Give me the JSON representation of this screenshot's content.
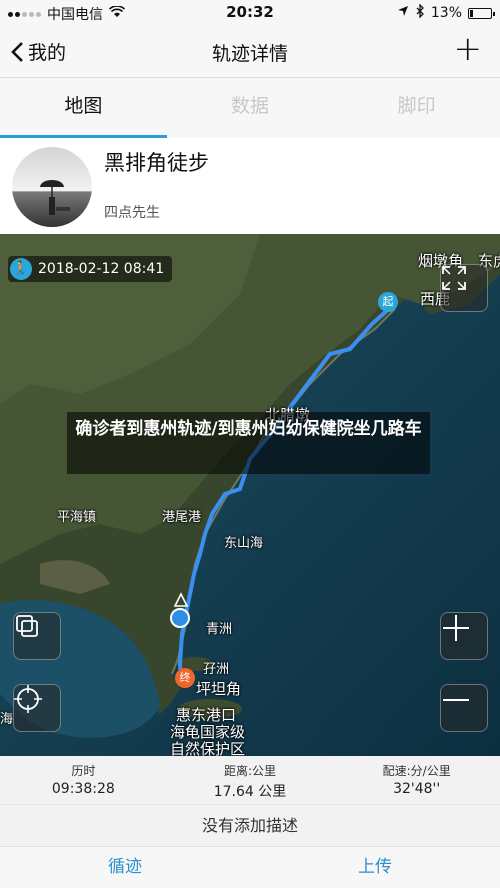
{
  "status_bar": {
    "carrier": "中国电信",
    "time": "20:32",
    "battery": "13%",
    "battery_level": 0.13
  },
  "nav": {
    "back_label": "我的",
    "title": "轨迹详情",
    "add_label": "+"
  },
  "tabs": [
    {
      "label": "地图",
      "active": true
    },
    {
      "label": "数据",
      "active": false
    },
    {
      "label": "脚印",
      "active": false
    }
  ],
  "user": {
    "name": "黑排角徒步",
    "nickname": "四点先生"
  },
  "map": {
    "start_time": "2018-02-12 08:41",
    "start_marker": "起",
    "end_marker": "终",
    "places": [
      "烟墩角",
      "东虎",
      "西鹿",
      "北腊墩",
      "平海镇",
      "港尾港",
      "东山海",
      "青洲",
      "孖洲",
      "坪坦角",
      "惠东港口",
      "海龟国家级",
      "自然保护区",
      "海"
    ],
    "overlay_text": "确诊者到惠州轨迹/到惠州妇幼保健院坐几路车",
    "route_color": "#3b8ff0"
  },
  "stats": [
    {
      "label": "历时",
      "value": "09:38:28"
    },
    {
      "label": "距离:公里",
      "value": "17.64 公里"
    },
    {
      "label": "配速:分/公里",
      "value": "32'48''"
    }
  ],
  "description": "没有添加描述",
  "actions": {
    "retrace": "循迹",
    "upload": "上传"
  }
}
